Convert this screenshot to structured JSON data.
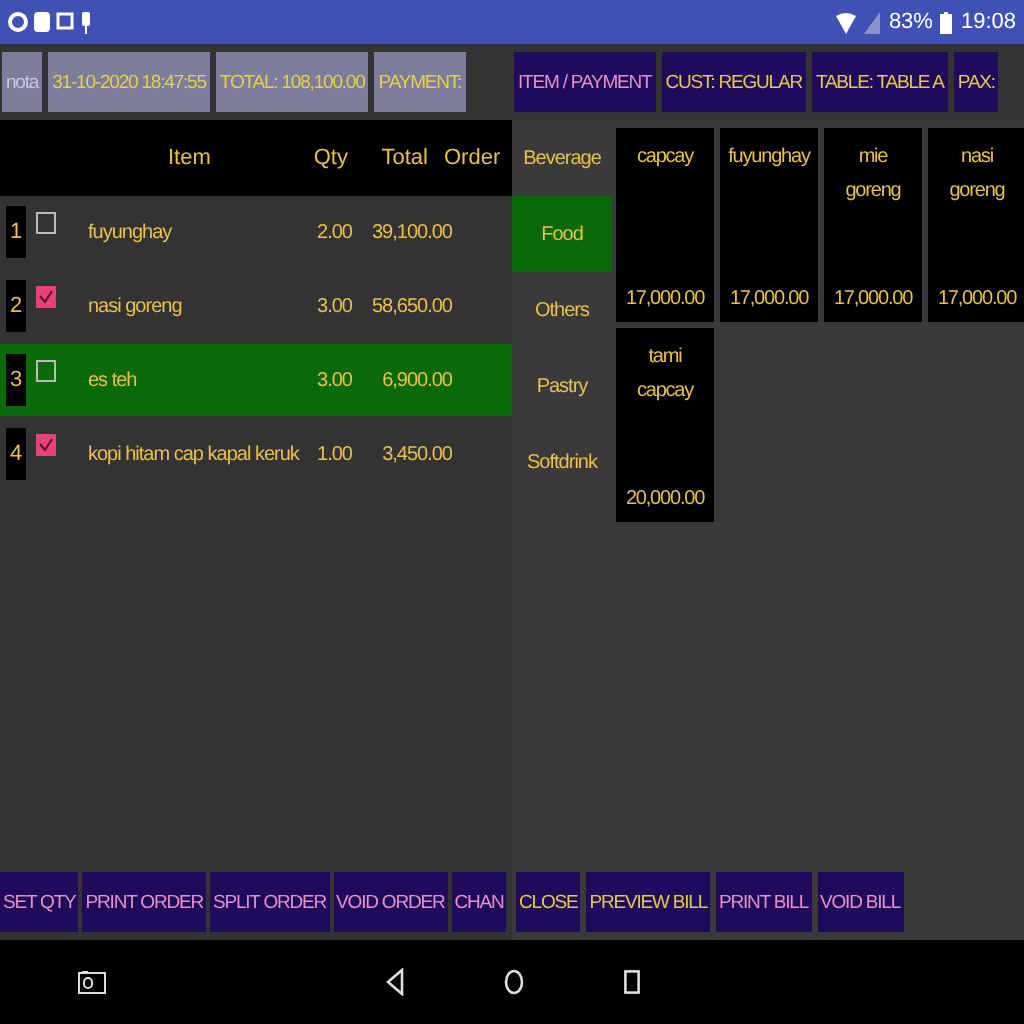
{
  "status_bar": {
    "battery": "83%",
    "time": "19:08"
  },
  "header_left": [
    {
      "label": "nota"
    },
    {
      "label": "31-10-2020 18:47:55"
    },
    {
      "label": "TOTAL: 108,100.00"
    },
    {
      "label": "PAYMENT:"
    }
  ],
  "header_right": [
    {
      "label": "ITEM / PAYMENT",
      "kind": "pink"
    },
    {
      "label": "CUST: REGULAR",
      "kind": "gold"
    },
    {
      "label": "TABLE: TABLE A",
      "kind": "gold"
    },
    {
      "label": "PAX:",
      "kind": "gold"
    }
  ],
  "table": {
    "columns": [
      "Item",
      "Qty",
      "Total",
      "Order"
    ],
    "rows": [
      {
        "no": "1",
        "checked": false,
        "item": "fuyunghay",
        "qty": "2.00",
        "total": "39,100.00",
        "selected": false
      },
      {
        "no": "2",
        "checked": true,
        "item": "nasi goreng",
        "qty": "3.00",
        "total": "58,650.00",
        "selected": false
      },
      {
        "no": "3",
        "checked": false,
        "item": "es teh",
        "qty": "3.00",
        "total": "6,900.00",
        "selected": true
      },
      {
        "no": "4",
        "checked": true,
        "item": "kopi hitam cap kapal keruk",
        "qty": "1.00",
        "total": "3,450.00",
        "selected": false
      }
    ]
  },
  "categories": [
    {
      "label": "Beverage",
      "selected": false
    },
    {
      "label": "Food",
      "selected": true
    },
    {
      "label": "Others",
      "selected": false
    },
    {
      "label": "Pastry",
      "selected": false
    },
    {
      "label": "Softdrink",
      "selected": false
    }
  ],
  "products": [
    {
      "name": "capcay",
      "price": "17,000.00"
    },
    {
      "name": "fuyunghay",
      "price": "17,000.00"
    },
    {
      "name": "mie goreng",
      "price": "17,000.00"
    },
    {
      "name": "nasi goreng",
      "price": "17,000.00"
    },
    {
      "name": "tami capcay",
      "price": "20,000.00"
    }
  ],
  "actions_left": [
    {
      "label": "SET QTY",
      "kind": "pink"
    },
    {
      "label": "PRINT ORDER",
      "kind": "pink"
    },
    {
      "label": "SPLIT ORDER",
      "kind": "pink"
    },
    {
      "label": "VOID ORDER",
      "kind": "pink"
    },
    {
      "label": "CHAN",
      "kind": "pink"
    }
  ],
  "actions_right": [
    {
      "label": "CLOSE",
      "kind": "gold"
    },
    {
      "label": "PREVIEW BILL",
      "kind": "gold"
    },
    {
      "label": "PRINT BILL",
      "kind": "pink"
    },
    {
      "label": "VOID BILL",
      "kind": "pink"
    }
  ]
}
